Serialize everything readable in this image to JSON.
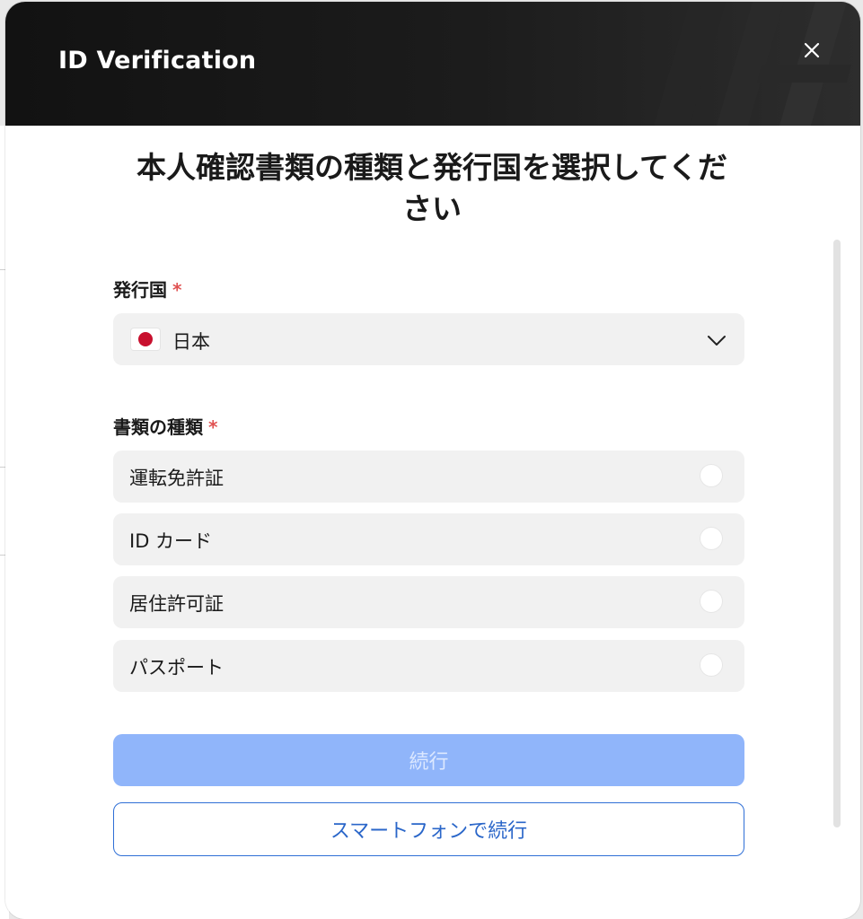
{
  "modal": {
    "title": "ID Verification"
  },
  "heading": {
    "line1": "本人確認書類の種類と発行国を選択してくだ",
    "line2": "さい"
  },
  "country": {
    "label": "発行国",
    "required_mark": "*",
    "selected": "日本",
    "flag_icon": "japan-flag-icon"
  },
  "document_type": {
    "label": "書類の種類",
    "required_mark": "*",
    "options": [
      {
        "label": "運転免許証",
        "selected": false
      },
      {
        "label": "ID カード",
        "selected": false
      },
      {
        "label": "居住許可証",
        "selected": false
      },
      {
        "label": "パスポート",
        "selected": false
      }
    ]
  },
  "actions": {
    "continue_label": "続行",
    "continue_enabled": false,
    "phone_label": "スマートフォンで続行"
  },
  "colors": {
    "header_bg": "#141414",
    "primary_disabled": "#90b5fa",
    "primary_text": "#2a66c9",
    "required": "#e05252",
    "option_bg": "#f1f1f1"
  }
}
